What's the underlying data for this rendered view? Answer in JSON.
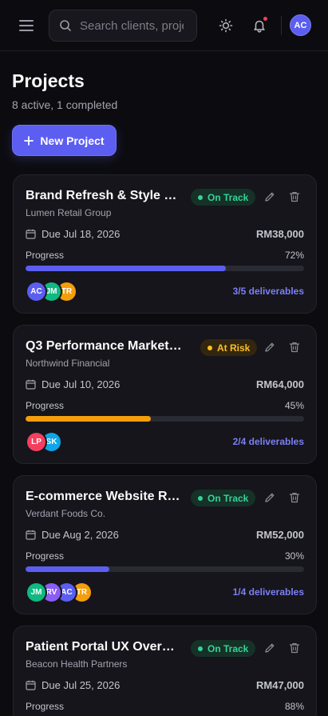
{
  "header": {
    "search_placeholder": "Search clients, projects...",
    "avatar_initials": "AC",
    "notification_count_visible": true
  },
  "page": {
    "title": "Projects",
    "subtitle": "8 active, 1 completed",
    "new_button_label": "New Project"
  },
  "colors": {
    "accent": "#5b5ef0",
    "on_track": "#34d399",
    "at_risk": "#fbbf24"
  },
  "projects": [
    {
      "title": "Brand Refresh & Style G...",
      "client": "Lumen Retail Group",
      "status": "On Track",
      "due": "Due Jul 18, 2026",
      "amount": "RM38,000",
      "progress_label": "Progress",
      "progress_pct": "72%",
      "progress_value": 0.72,
      "progress_color": "#5b5ef0",
      "deliverables": "3/5 deliverables",
      "team": [
        {
          "initials": "AC",
          "color": "#5b5ef0"
        },
        {
          "initials": "JM",
          "color": "#10b981"
        },
        {
          "initials": "TR",
          "color": "#f59e0b"
        }
      ]
    },
    {
      "title": "Q3 Performance Marketin...",
      "client": "Northwind Financial",
      "status": "At Risk",
      "due": "Due Jul 10, 2026",
      "amount": "RM64,000",
      "progress_label": "Progress",
      "progress_pct": "45%",
      "progress_value": 0.45,
      "progress_color": "#f59e0b",
      "deliverables": "2/4 deliverables",
      "team": [
        {
          "initials": "LP",
          "color": "#f43f5e"
        },
        {
          "initials": "SK",
          "color": "#0ea5e9"
        }
      ]
    },
    {
      "title": "E-commerce Website Re...",
      "client": "Verdant Foods Co.",
      "status": "On Track",
      "due": "Due Aug 2, 2026",
      "amount": "RM52,000",
      "progress_label": "Progress",
      "progress_pct": "30%",
      "progress_value": 0.3,
      "progress_color": "#5b5ef0",
      "deliverables": "1/4 deliverables",
      "team": [
        {
          "initials": "JM",
          "color": "#10b981"
        },
        {
          "initials": "RV",
          "color": "#8b5cf6"
        },
        {
          "initials": "AC",
          "color": "#5b5ef0"
        },
        {
          "initials": "TR",
          "color": "#f59e0b"
        }
      ]
    },
    {
      "title": "Patient Portal UX Overhaul",
      "client": "Beacon Health Partners",
      "status": "On Track",
      "due": "Due Jul 25, 2026",
      "amount": "RM47,000",
      "progress_label": "Progress",
      "progress_pct": "88%",
      "progress_value": 0.88,
      "progress_color": "#5b5ef0",
      "deliverables": "",
      "team": []
    }
  ]
}
